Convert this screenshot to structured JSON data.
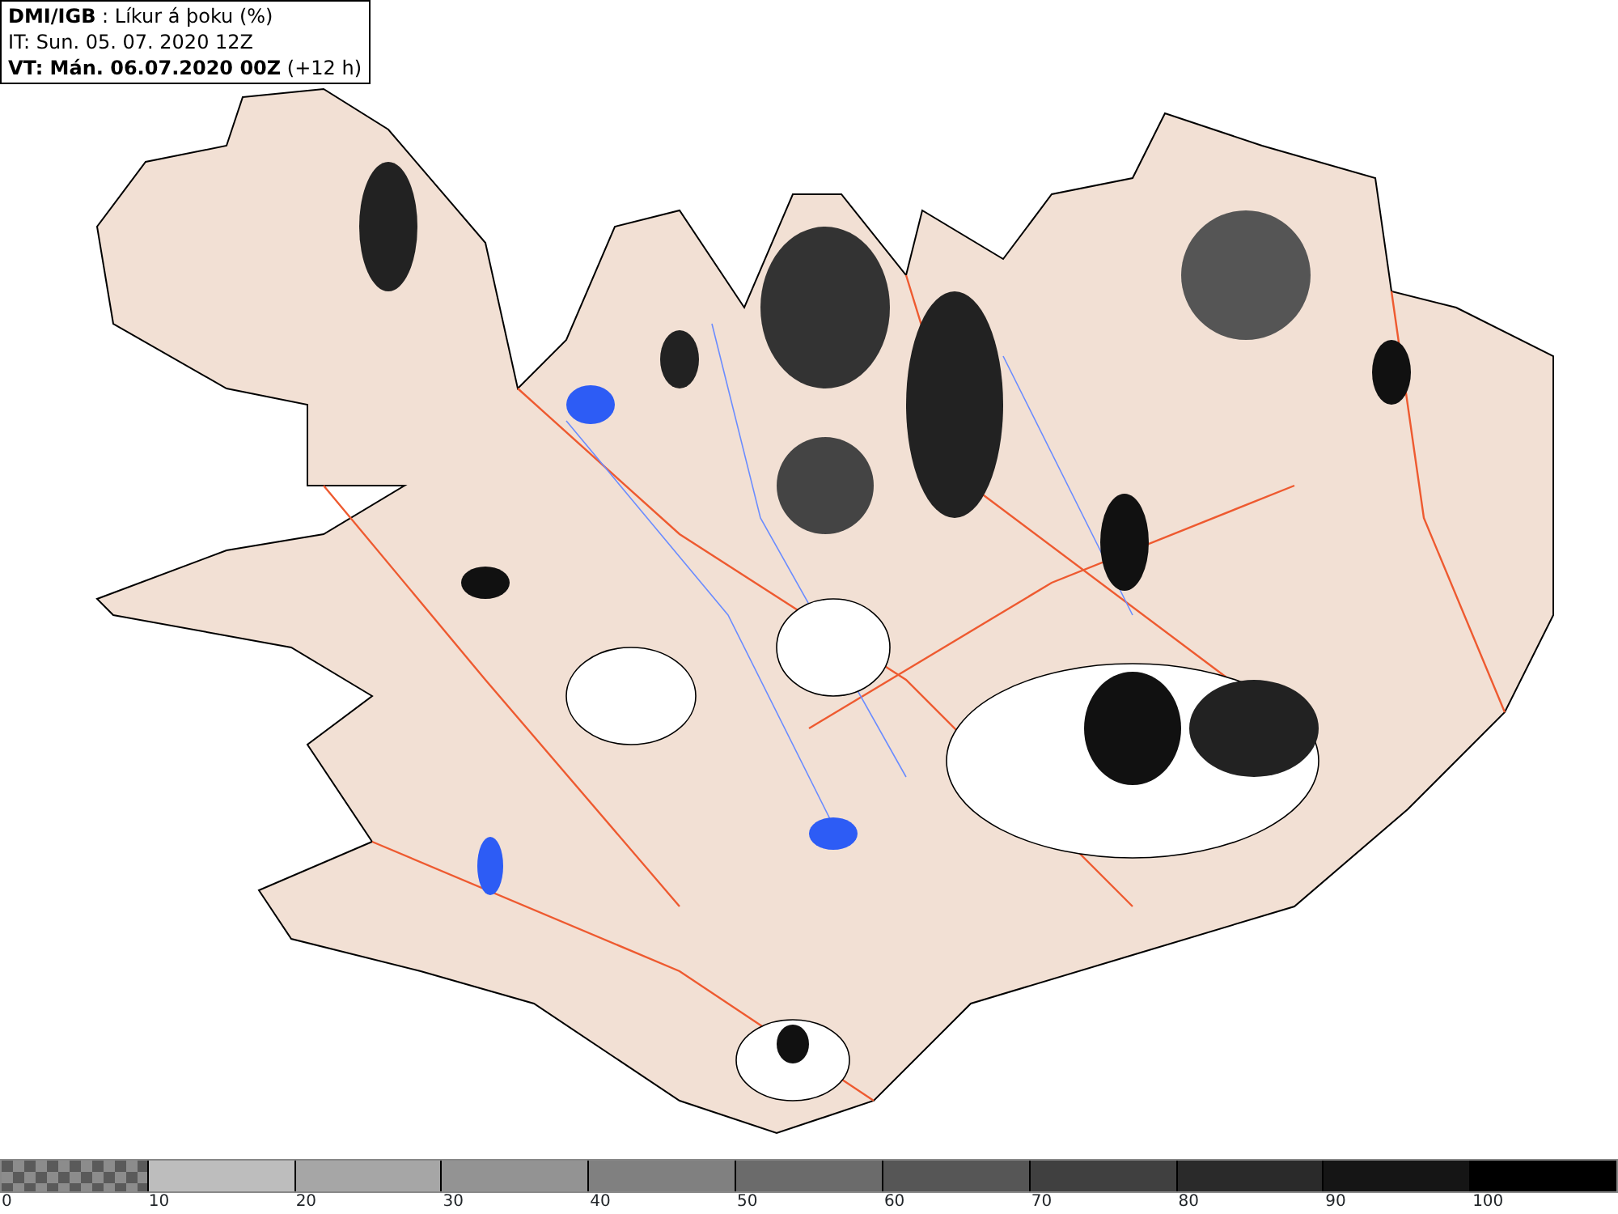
{
  "header": {
    "lines": [
      "**DMI/IGB** : Líkur á þoku (%)",
      "IT: Sun. 05. 07. 2020 12Z",
      "**VT: Mán. 06.07.2020 00Z** (+12 h)"
    ]
  },
  "legend": {
    "segments": [
      {
        "kind": "checker"
      },
      {
        "kind": "solid",
        "color": "#bdbdbd"
      },
      {
        "kind": "solid",
        "color": "#a6a6a6"
      },
      {
        "kind": "solid",
        "color": "#939393"
      },
      {
        "kind": "solid",
        "color": "#808080"
      },
      {
        "kind": "solid",
        "color": "#6b6b6b"
      },
      {
        "kind": "solid",
        "color": "#565656"
      },
      {
        "kind": "solid",
        "color": "#404040"
      },
      {
        "kind": "solid",
        "color": "#2a2a2a"
      },
      {
        "kind": "solid",
        "color": "#151515"
      },
      {
        "kind": "solid",
        "color": "#000000"
      }
    ],
    "labels": [
      "0",
      "10",
      "20",
      "30",
      "40",
      "50",
      "60",
      "70",
      "80",
      "90",
      "100"
    ]
  }
}
